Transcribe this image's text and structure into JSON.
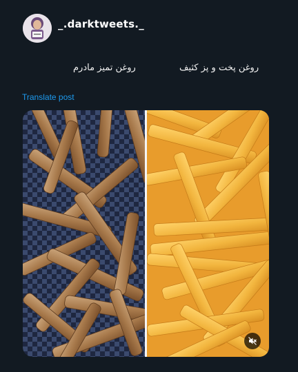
{
  "post": {
    "username": "_.darktweets._",
    "caption_left": "روغن تمیز مادرم",
    "caption_right": "روغن پخت و پز کثیف",
    "translate_label": "Translate post"
  },
  "media": {
    "left_image": "dark-oil-fries",
    "right_image": "golden-fries",
    "mute_icon": "speaker-muted-icon"
  },
  "colors": {
    "background": "#121a22",
    "link": "#1d9bf0",
    "dark_fries": "#a7794b",
    "golden_fries": "#f2b53e"
  }
}
